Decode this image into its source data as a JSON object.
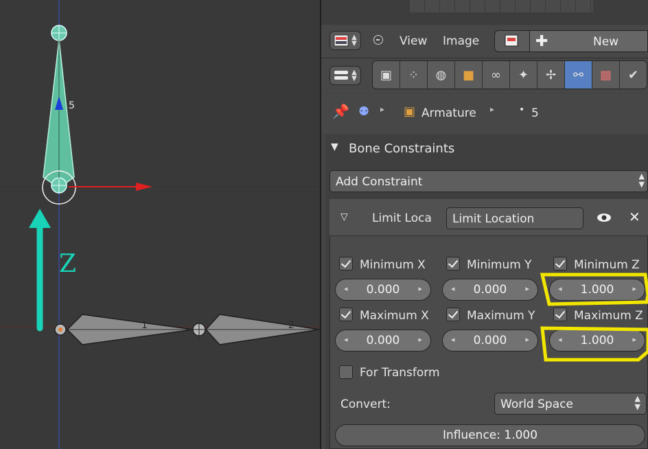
{
  "viewport": {
    "bone_labels": [
      "5",
      "1",
      "2"
    ],
    "axis_letter": "Z"
  },
  "header": {
    "menu_view": "View",
    "menu_image": "Image",
    "new_button": "New"
  },
  "context_tabs": [
    "render-icon",
    "render-layers-icon",
    "world-icon",
    "object-icon",
    "constraints-icon",
    "data-icon",
    "bone-icon",
    "bone-constraint-icon",
    "texture-icon",
    "brush-icon"
  ],
  "breadcrumb": {
    "object": "Armature",
    "bone": "5"
  },
  "panel": {
    "title": "Bone Constraints",
    "add_constraint": "Add Constraint",
    "constraint": {
      "type_label": "Limit Loca",
      "name": "Limit Location",
      "min": [
        {
          "label": "Minimum X",
          "checked": true,
          "value": "0.000"
        },
        {
          "label": "Minimum Y",
          "checked": true,
          "value": "0.000"
        },
        {
          "label": "Minimum Z",
          "checked": true,
          "value": "1.000"
        }
      ],
      "max": [
        {
          "label": "Maximum X",
          "checked": true,
          "value": "0.000"
        },
        {
          "label": "Maximum Y",
          "checked": true,
          "value": "0.000"
        },
        {
          "label": "Maximum Z",
          "checked": true,
          "value": "1.000"
        }
      ],
      "for_transform": "For Transform",
      "convert_label": "Convert:",
      "convert_value": "World Space",
      "influence": "Influence: 1.000"
    }
  },
  "colors": {
    "selected_bone": "#5fbf9f",
    "annotation_arrow": "#19d3b8",
    "highlight": "#f2e600",
    "x_axis": "#e02020",
    "active_tab": "#5680c2"
  }
}
